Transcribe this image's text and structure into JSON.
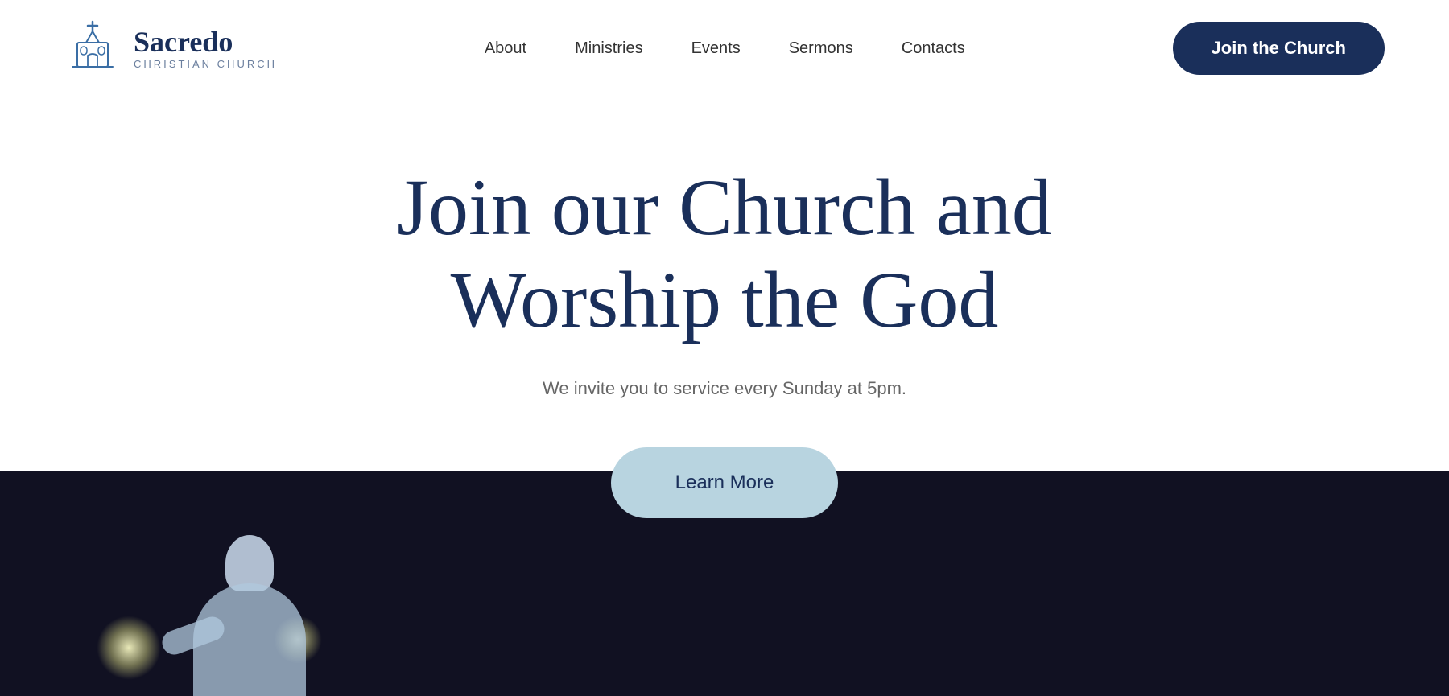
{
  "header": {
    "logo": {
      "name": "Sacredo",
      "subtitle": "CHRISTIAN CHURCH"
    },
    "nav": {
      "items": [
        {
          "label": "About",
          "id": "about"
        },
        {
          "label": "Ministries",
          "id": "ministries"
        },
        {
          "label": "Events",
          "id": "events"
        },
        {
          "label": "Sermons",
          "id": "sermons"
        },
        {
          "label": "Contacts",
          "id": "contacts"
        }
      ],
      "cta_label": "Join the Church"
    }
  },
  "hero": {
    "title_line1": "Join our Church and",
    "title_line2": "Worship the God",
    "subtitle": "We invite you to service every Sunday at 5pm.",
    "learn_more_label": "Learn More"
  },
  "colors": {
    "brand_dark": "#1a2f5a",
    "brand_light_blue": "#b8d4e0",
    "nav_text": "#333333",
    "subtitle_text": "#666666"
  }
}
